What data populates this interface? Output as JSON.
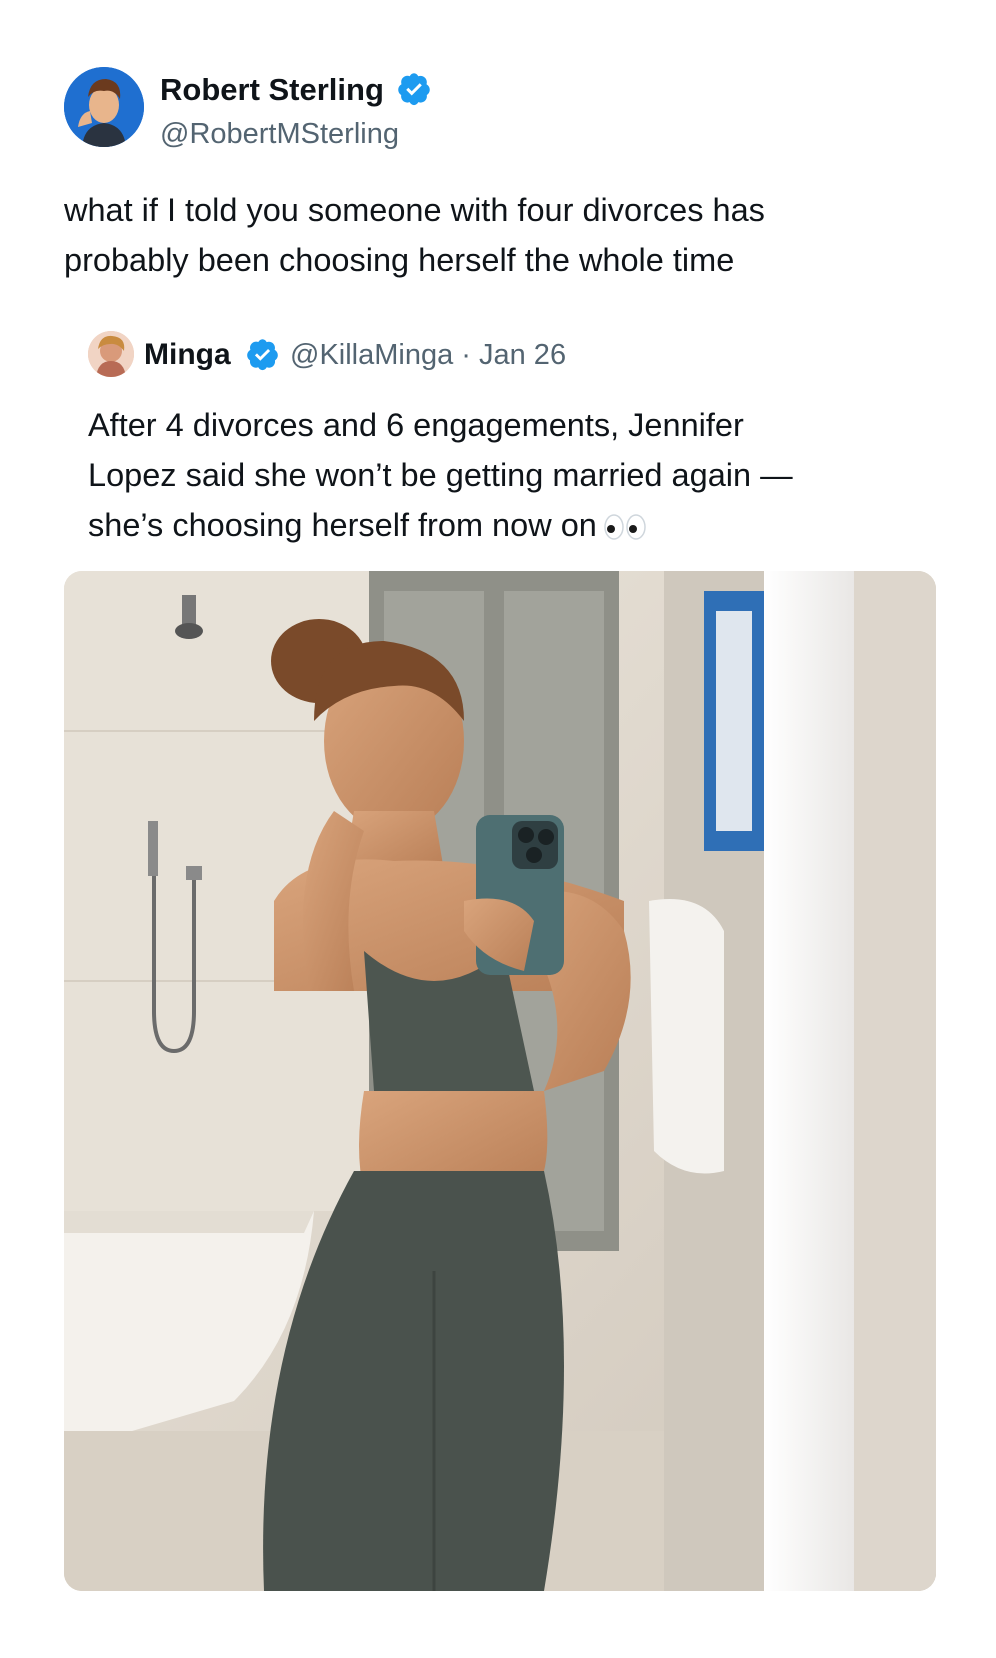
{
  "tweet": {
    "author": {
      "name": "Robert Sterling",
      "handle": "@RobertMSterling",
      "verified": true,
      "avatar": "cartoon-avatar"
    },
    "text_lines": [
      "what if I told you someone with four divorces has",
      "probably been choosing herself the whole time"
    ],
    "quoted": {
      "author": {
        "name": "Minga",
        "handle": "@KillaMinga",
        "verified": true,
        "avatar": "illustrated-avatar"
      },
      "meta": "@KillaMinga · Jan 26",
      "text_lines": [
        "After 4 divorces and 6 engagements, Jennifer",
        "Lopez said she won’t be getting married again —",
        "she’s choosing herself from now on"
      ],
      "emoji": "eyes-icon",
      "media": "mirror-selfie-photo"
    }
  },
  "colors": {
    "text": "#0f1419",
    "secondary": "#536471",
    "verified": "#1d9bf0",
    "background": "#ffffff"
  }
}
